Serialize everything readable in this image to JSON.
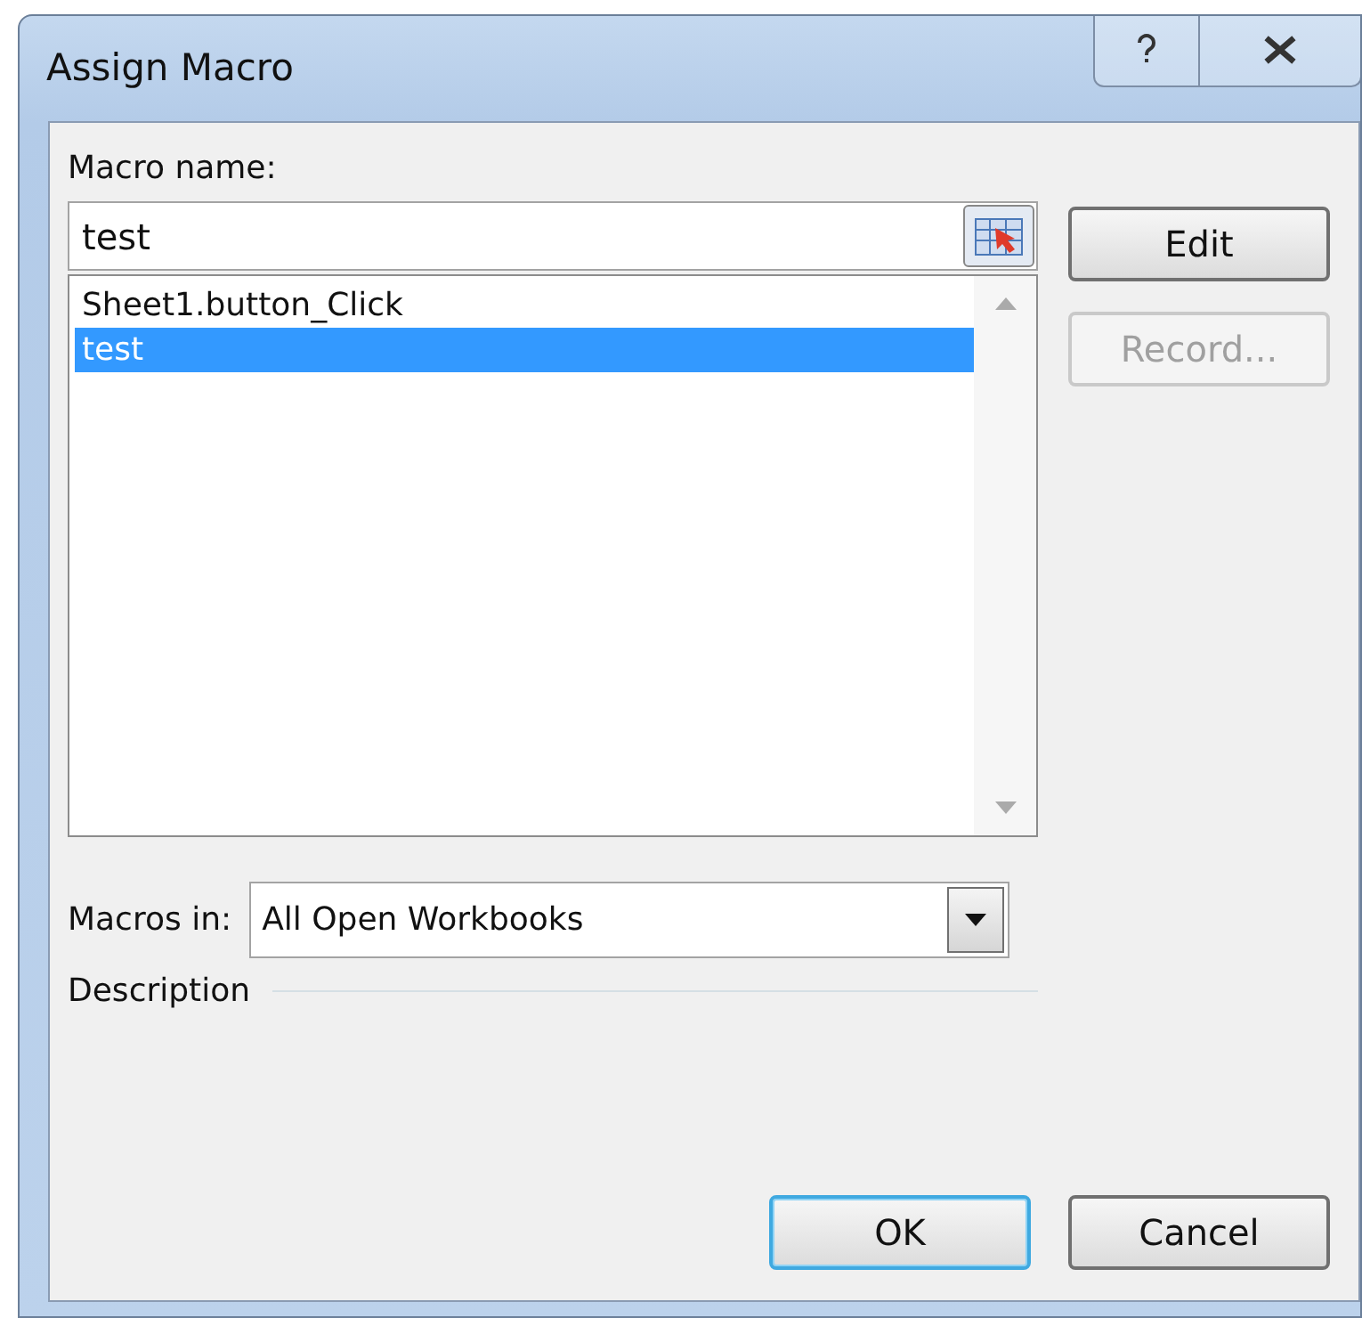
{
  "window": {
    "title": "Assign Macro"
  },
  "macro_name": {
    "label": "Macro name:",
    "value": "test"
  },
  "macro_list": [
    {
      "label": "Sheet1.button_Click",
      "selected": false
    },
    {
      "label": "test",
      "selected": true
    }
  ],
  "side_buttons": [
    {
      "label": "Edit",
      "disabled": false
    },
    {
      "label": "Record...",
      "disabled": true
    }
  ],
  "macros_in": {
    "label": "Macros in:",
    "value": "All Open Workbooks"
  },
  "description": {
    "label": "Description"
  },
  "footer_buttons": [
    {
      "label": "OK",
      "focused": true
    },
    {
      "label": "Cancel",
      "focused": false
    }
  ]
}
